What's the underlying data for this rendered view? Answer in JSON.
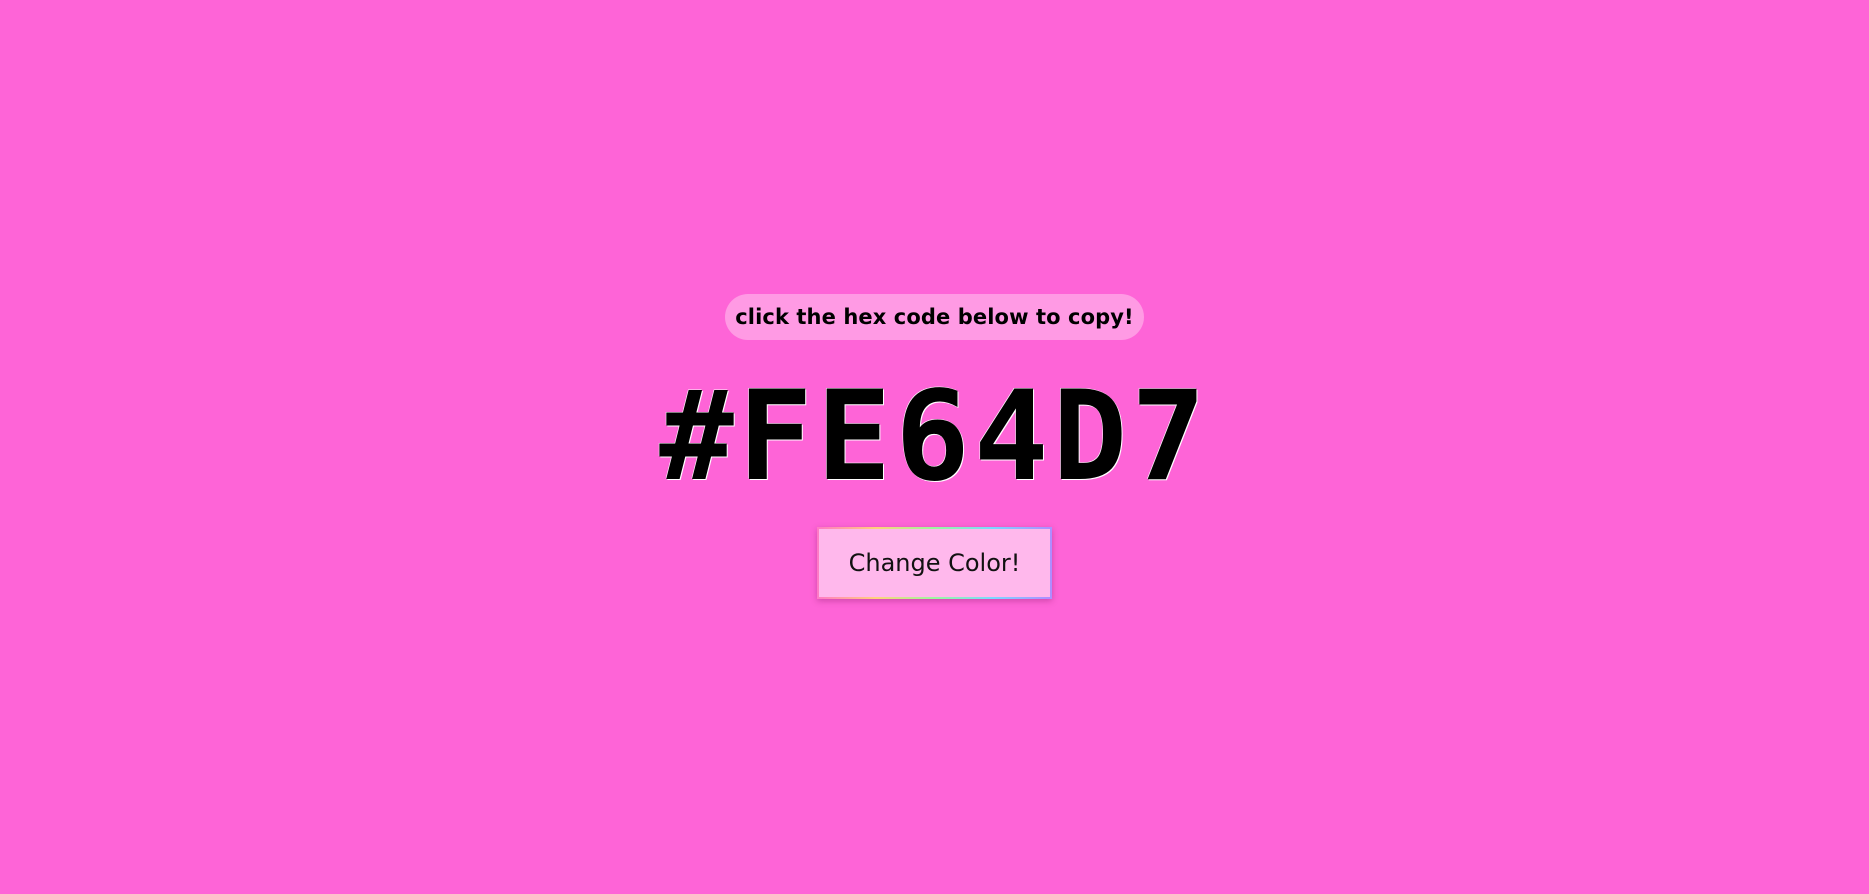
{
  "hint": {
    "text": "click the hex code below to copy!"
  },
  "color": {
    "hex_label": "#FE64D7",
    "background": "#fe64d7"
  },
  "button": {
    "label": "Change Color!"
  }
}
